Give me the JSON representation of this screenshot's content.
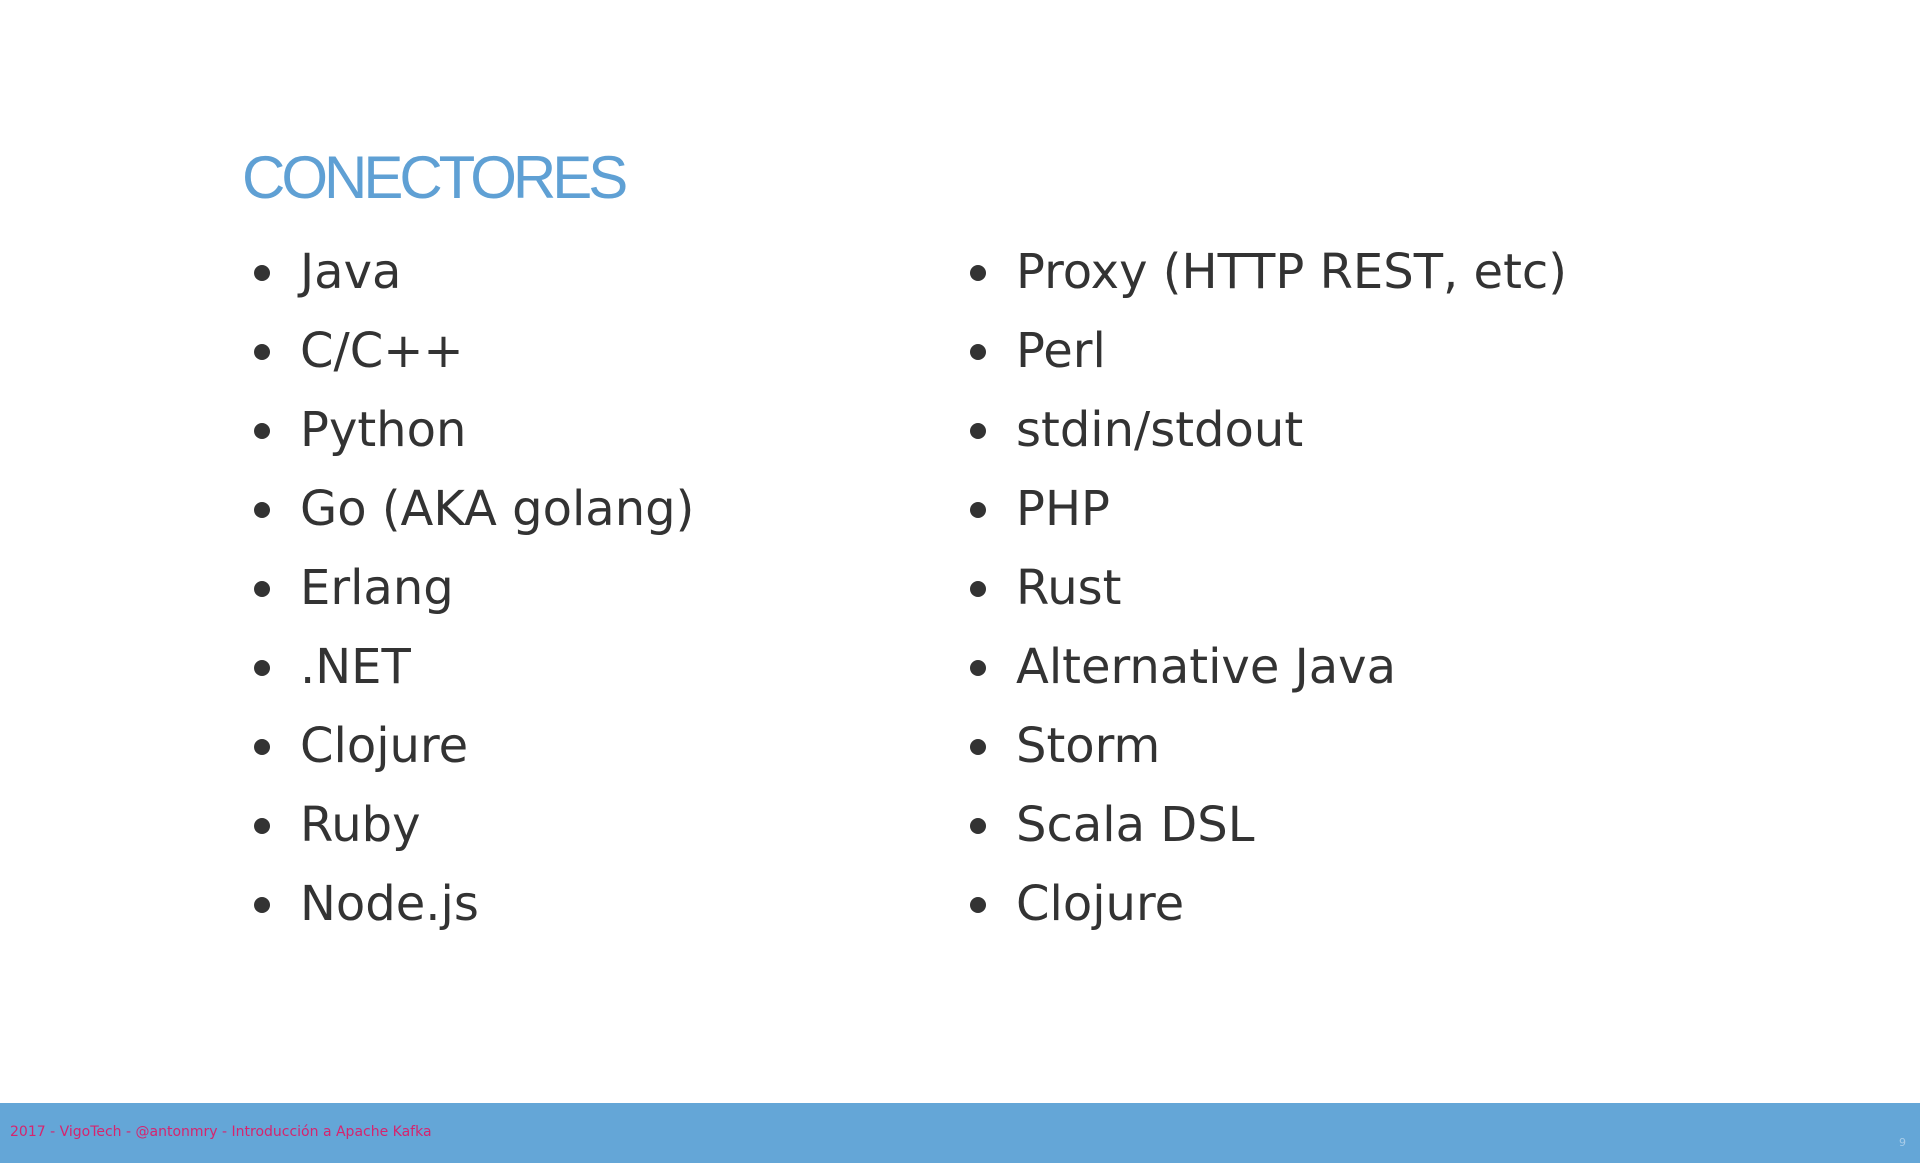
{
  "slide": {
    "title": "CONECTORES",
    "left_column": [
      {
        "label": "Java"
      },
      {
        "label": "C/C++"
      },
      {
        "label": "Python"
      },
      {
        "label": "Go (AKA golang)"
      },
      {
        "label": "Erlang"
      },
      {
        "label": ".NET"
      },
      {
        "label": "Clojure"
      },
      {
        "label": "Ruby"
      },
      {
        "label": "Node.js"
      }
    ],
    "right_column": [
      {
        "label": "Proxy (HTTP REST, etc)"
      },
      {
        "label": "Perl"
      },
      {
        "label": "stdin/stdout"
      },
      {
        "label": "PHP"
      },
      {
        "label": "Rust"
      },
      {
        "label": "Alternative Java"
      },
      {
        "label": "Storm"
      },
      {
        "label": "Scala DSL"
      },
      {
        "label": "Clojure"
      }
    ]
  },
  "footer": {
    "text": "2017 - VigoTech - @antonmry - Introducción a Apache Kafka",
    "page_number": "9"
  },
  "colors": {
    "title": "#5fa0d4",
    "text": "#333333",
    "footer_background": "#64a6d7",
    "footer_text": "#d6246e"
  }
}
